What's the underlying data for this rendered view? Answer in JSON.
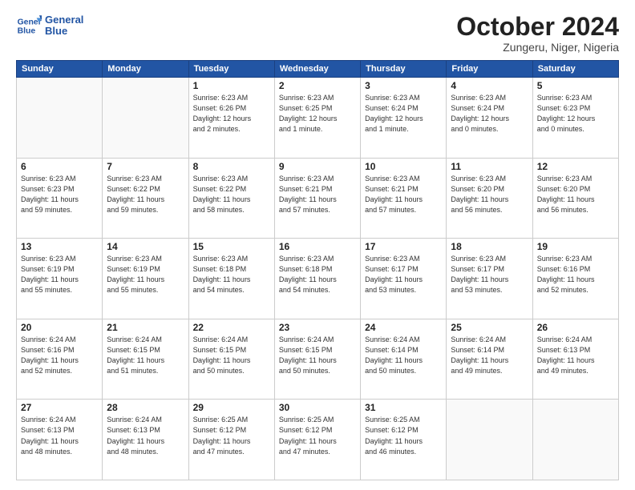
{
  "header": {
    "logo_line1": "General",
    "logo_line2": "Blue",
    "month": "October 2024",
    "location": "Zungeru, Niger, Nigeria"
  },
  "weekdays": [
    "Sunday",
    "Monday",
    "Tuesday",
    "Wednesday",
    "Thursday",
    "Friday",
    "Saturday"
  ],
  "weeks": [
    [
      {
        "day": "",
        "info": ""
      },
      {
        "day": "",
        "info": ""
      },
      {
        "day": "1",
        "info": "Sunrise: 6:23 AM\nSunset: 6:26 PM\nDaylight: 12 hours\nand 2 minutes."
      },
      {
        "day": "2",
        "info": "Sunrise: 6:23 AM\nSunset: 6:25 PM\nDaylight: 12 hours\nand 1 minute."
      },
      {
        "day": "3",
        "info": "Sunrise: 6:23 AM\nSunset: 6:24 PM\nDaylight: 12 hours\nand 1 minute."
      },
      {
        "day": "4",
        "info": "Sunrise: 6:23 AM\nSunset: 6:24 PM\nDaylight: 12 hours\nand 0 minutes."
      },
      {
        "day": "5",
        "info": "Sunrise: 6:23 AM\nSunset: 6:23 PM\nDaylight: 12 hours\nand 0 minutes."
      }
    ],
    [
      {
        "day": "6",
        "info": "Sunrise: 6:23 AM\nSunset: 6:23 PM\nDaylight: 11 hours\nand 59 minutes."
      },
      {
        "day": "7",
        "info": "Sunrise: 6:23 AM\nSunset: 6:22 PM\nDaylight: 11 hours\nand 59 minutes."
      },
      {
        "day": "8",
        "info": "Sunrise: 6:23 AM\nSunset: 6:22 PM\nDaylight: 11 hours\nand 58 minutes."
      },
      {
        "day": "9",
        "info": "Sunrise: 6:23 AM\nSunset: 6:21 PM\nDaylight: 11 hours\nand 57 minutes."
      },
      {
        "day": "10",
        "info": "Sunrise: 6:23 AM\nSunset: 6:21 PM\nDaylight: 11 hours\nand 57 minutes."
      },
      {
        "day": "11",
        "info": "Sunrise: 6:23 AM\nSunset: 6:20 PM\nDaylight: 11 hours\nand 56 minutes."
      },
      {
        "day": "12",
        "info": "Sunrise: 6:23 AM\nSunset: 6:20 PM\nDaylight: 11 hours\nand 56 minutes."
      }
    ],
    [
      {
        "day": "13",
        "info": "Sunrise: 6:23 AM\nSunset: 6:19 PM\nDaylight: 11 hours\nand 55 minutes."
      },
      {
        "day": "14",
        "info": "Sunrise: 6:23 AM\nSunset: 6:19 PM\nDaylight: 11 hours\nand 55 minutes."
      },
      {
        "day": "15",
        "info": "Sunrise: 6:23 AM\nSunset: 6:18 PM\nDaylight: 11 hours\nand 54 minutes."
      },
      {
        "day": "16",
        "info": "Sunrise: 6:23 AM\nSunset: 6:18 PM\nDaylight: 11 hours\nand 54 minutes."
      },
      {
        "day": "17",
        "info": "Sunrise: 6:23 AM\nSunset: 6:17 PM\nDaylight: 11 hours\nand 53 minutes."
      },
      {
        "day": "18",
        "info": "Sunrise: 6:23 AM\nSunset: 6:17 PM\nDaylight: 11 hours\nand 53 minutes."
      },
      {
        "day": "19",
        "info": "Sunrise: 6:23 AM\nSunset: 6:16 PM\nDaylight: 11 hours\nand 52 minutes."
      }
    ],
    [
      {
        "day": "20",
        "info": "Sunrise: 6:24 AM\nSunset: 6:16 PM\nDaylight: 11 hours\nand 52 minutes."
      },
      {
        "day": "21",
        "info": "Sunrise: 6:24 AM\nSunset: 6:15 PM\nDaylight: 11 hours\nand 51 minutes."
      },
      {
        "day": "22",
        "info": "Sunrise: 6:24 AM\nSunset: 6:15 PM\nDaylight: 11 hours\nand 50 minutes."
      },
      {
        "day": "23",
        "info": "Sunrise: 6:24 AM\nSunset: 6:15 PM\nDaylight: 11 hours\nand 50 minutes."
      },
      {
        "day": "24",
        "info": "Sunrise: 6:24 AM\nSunset: 6:14 PM\nDaylight: 11 hours\nand 50 minutes."
      },
      {
        "day": "25",
        "info": "Sunrise: 6:24 AM\nSunset: 6:14 PM\nDaylight: 11 hours\nand 49 minutes."
      },
      {
        "day": "26",
        "info": "Sunrise: 6:24 AM\nSunset: 6:13 PM\nDaylight: 11 hours\nand 49 minutes."
      }
    ],
    [
      {
        "day": "27",
        "info": "Sunrise: 6:24 AM\nSunset: 6:13 PM\nDaylight: 11 hours\nand 48 minutes."
      },
      {
        "day": "28",
        "info": "Sunrise: 6:24 AM\nSunset: 6:13 PM\nDaylight: 11 hours\nand 48 minutes."
      },
      {
        "day": "29",
        "info": "Sunrise: 6:25 AM\nSunset: 6:12 PM\nDaylight: 11 hours\nand 47 minutes."
      },
      {
        "day": "30",
        "info": "Sunrise: 6:25 AM\nSunset: 6:12 PM\nDaylight: 11 hours\nand 47 minutes."
      },
      {
        "day": "31",
        "info": "Sunrise: 6:25 AM\nSunset: 6:12 PM\nDaylight: 11 hours\nand 46 minutes."
      },
      {
        "day": "",
        "info": ""
      },
      {
        "day": "",
        "info": ""
      }
    ]
  ]
}
